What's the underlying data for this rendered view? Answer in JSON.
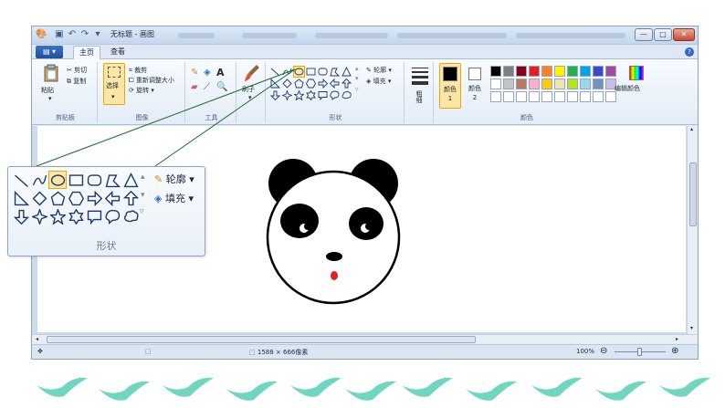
{
  "window": {
    "title": "无标题 - 画图",
    "controls": {
      "minimize": "—",
      "maximize": "□",
      "close": "✕"
    }
  },
  "ribbon": {
    "menu_button": "▾",
    "tabs": [
      {
        "label": "主页",
        "selected": true
      },
      {
        "label": "查看",
        "selected": false
      }
    ],
    "help": "?",
    "clipboard": {
      "paste": "粘贴",
      "cut": "剪切",
      "copy": "复制",
      "group_label": "剪贴板"
    },
    "image": {
      "select": "选择",
      "crop": "裁剪",
      "resize": "重新调整大小",
      "rotate": "旋转",
      "group_label": "图像"
    },
    "tools": {
      "group_label": "工具"
    },
    "brushes": {
      "label": "刷子"
    },
    "shapes": {
      "outline": "轮廓",
      "fill": "填充",
      "group_label": "形状"
    },
    "size": {
      "label": "粗细"
    },
    "colors": {
      "color1_label": "颜色 1",
      "color2_label": "颜色 2",
      "edit_colors": "编辑颜色",
      "group_label": "颜色",
      "color1": "#000000",
      "color2": "#ffffff",
      "palette_row1": [
        "#000000",
        "#7f7f7f",
        "#880015",
        "#ed1c24",
        "#ff7f27",
        "#fff200",
        "#22b14c",
        "#00a2e8",
        "#3f48cc",
        "#a349a4"
      ],
      "palette_row2": [
        "#ffffff",
        "#c3c3c3",
        "#b97a57",
        "#ffaec9",
        "#ffc90e",
        "#efe4b0",
        "#b5e61d",
        "#99d9ea",
        "#7092be",
        "#c8bfe7"
      ]
    }
  },
  "status": {
    "canvas_size": "1588 × 666像素",
    "zoom": "100%",
    "zoom_out": "⊖",
    "zoom_in": "⊕",
    "move_icon": "✥"
  },
  "callout": {
    "outline": "轮廓",
    "fill": "填充",
    "label": "形状"
  },
  "colors": {
    "accent_bird": "#6fd6c0",
    "ribbon_bg": "#e3ecf7",
    "selection_highlight": "#fde5a4",
    "panda_mouth": "#e41e26"
  }
}
